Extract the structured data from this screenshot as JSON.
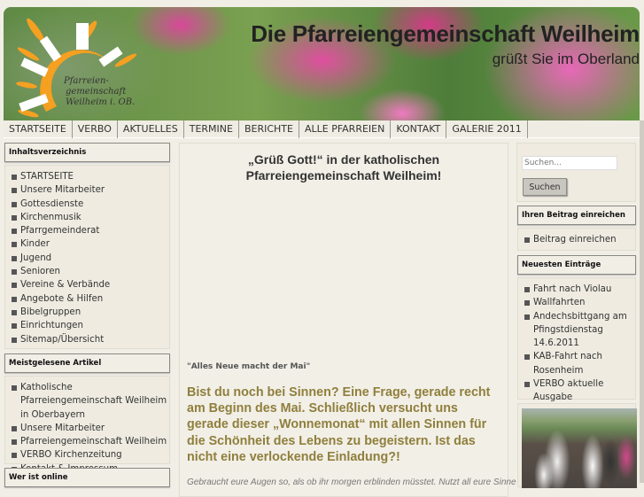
{
  "header": {
    "title": "Die Pfarreiengemeinschaft Weilheim",
    "subtitle": "grüßt Sie im Oberland",
    "logo_text": "Pfarreien-gemeinschaft Weilheim i. OB."
  },
  "nav": [
    "STARTSEITE",
    "VERBO",
    "AKTUELLES",
    "TERMINE",
    "BERICHTE",
    "ALLE PFARREIEN",
    "KONTAKT",
    "GALERIE 2011"
  ],
  "left": {
    "toc_title": "Inhaltsverzeichnis",
    "toc": [
      "STARTSEITE",
      "Unsere Mitarbeiter",
      "Gottesdienste",
      "Kirchenmusik",
      "Pfarrgemeinderat",
      "Kinder",
      "Jugend",
      "Senioren",
      "Vereine & Verbände",
      "Angebote & Hilfen",
      "Bibelgruppen",
      "Einrichtungen",
      "Sitemap/Übersicht"
    ],
    "popular_title": "Meistgelesene Artikel",
    "popular": [
      "Katholische Pfarreiengemeinschaft Weilheim in Oberbayern",
      "Unsere Mitarbeiter",
      "Pfarreiengemeinschaft Weilheim",
      "VERBO Kirchenzeitung",
      "Kontakt & Impressum"
    ],
    "online_title": "Wer ist online"
  },
  "main": {
    "title_line1": "„Grüß Gott!“ in der katholischen",
    "title_line2": "Pfarreiengemeinschaft Weilheim!",
    "quote": "\"Alles Neue macht der Mai\"",
    "lead": "Bist du noch bei Sinnen? Eine Frage, gerade recht am Beginn des Mai. Schließlich versucht uns gerade dieser „Wonnemonat“ mit allen Sinnen für die Schönheit des Lebens zu begeistern. Ist das nicht eine verlockende Einladung?!",
    "body": "Gebraucht eure Augen so, als ob ihr morgen erblinden müsstet. Nutzt all eure Sinne"
  },
  "right": {
    "search_placeholder": "Suchen...",
    "search_button": "Suchen",
    "submit_title": "Ihren Beitrag einreichen",
    "submit_items": [
      "Beitrag einreichen"
    ],
    "latest_title": "Neuesten Einträge",
    "latest": [
      "Fahrt nach Violau",
      "Wallfahrten",
      "Andechsbittgang am Pfingstdienstag 14.6.2011",
      "KAB-Fahrt nach Rosenheim",
      "VERBO aktuelle Ausgabe"
    ]
  },
  "colors": {
    "lead": "#8f7f3c",
    "background": "#f1eee6"
  }
}
